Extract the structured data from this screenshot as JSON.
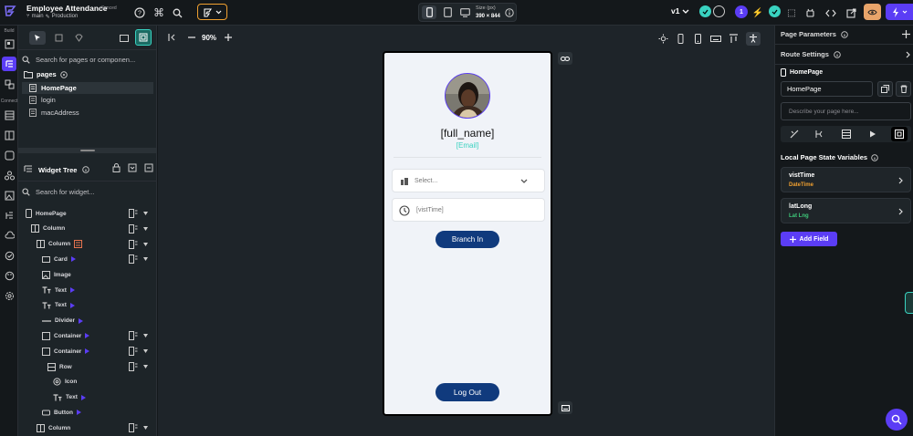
{
  "app": {
    "project_title": "Employee Attendance",
    "sync_status": "Synced",
    "branch": "main",
    "environment": "Production"
  },
  "device": {
    "size_label": "Size (px)",
    "size_value": "390 × 844"
  },
  "toolbar": {
    "version": "v1",
    "notification_count": "1"
  },
  "rail": {
    "build_label": "Build",
    "connect_label": "Connect"
  },
  "left_panel": {
    "search_placeholder": "Search for pages or componen...",
    "pages_header": "pages",
    "pages": [
      "HomePage",
      "login",
      "macAddress"
    ],
    "widget_tree_title": "Widget Tree",
    "widget_search_placeholder": "Search for widget...",
    "tree": [
      {
        "label": "HomePage",
        "icon": "phone-icon"
      },
      {
        "label": "Column",
        "icon": "column-icon"
      },
      {
        "label": "Column",
        "icon": "column-icon"
      },
      {
        "label": "Card",
        "icon": "card-icon"
      },
      {
        "label": "Image",
        "icon": "image-icon"
      },
      {
        "label": "Text",
        "icon": "text-icon"
      },
      {
        "label": "Text",
        "icon": "text-icon"
      },
      {
        "label": "Divider",
        "icon": "divider-icon"
      },
      {
        "label": "Container",
        "icon": "container-icon"
      },
      {
        "label": "Container",
        "icon": "container-icon"
      },
      {
        "label": "Row",
        "icon": "row-icon"
      },
      {
        "label": "Icon",
        "icon": "icon-widget-icon"
      },
      {
        "label": "Text",
        "icon": "text-icon"
      },
      {
        "label": "Button",
        "icon": "button-icon"
      },
      {
        "label": "Column",
        "icon": "column-icon"
      }
    ]
  },
  "canvas": {
    "zoom": "90%"
  },
  "phone": {
    "full_name": "[full_name]",
    "email": "[Email]",
    "select_placeholder": "Select...",
    "visit_time": "[vistTime]",
    "branch_in": "Branch In",
    "log_out": "Log Out"
  },
  "right_panel": {
    "page_parameters": "Page Parameters",
    "route_settings": "Route Settings",
    "page_name_label": "HomePage",
    "page_name_value": "HomePage",
    "description_placeholder": "Describe your page here...",
    "local_state_title": "Local Page State Variables",
    "variables": [
      {
        "name": "vistTime",
        "type": "DateTime",
        "type_color": "#f0a030"
      },
      {
        "name": "latLong",
        "type": "Lat Lng",
        "type_color": "#3ec97a"
      }
    ],
    "add_field": "Add Field"
  },
  "colors": {
    "accent": "#5b3df5",
    "teal": "#39d2c0",
    "navy_button": "#103a7d",
    "orange_border": "#f0a030"
  }
}
